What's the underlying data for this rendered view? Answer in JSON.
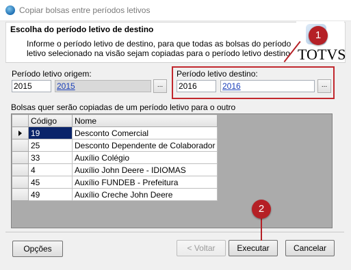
{
  "window": {
    "title": "Copiar bolsas entre períodos letivos"
  },
  "header": {
    "title": "Escolha do período letivo de destino",
    "description": "Informe o período letivo de destino, para que todas as bolsas do período letivo selecionado na visão sejam copiadas para o período letivo destino",
    "logo_text": "TOTVS"
  },
  "origin": {
    "label": "Período letivo origem:",
    "code": "2015",
    "display": "2015",
    "browse_label": "..."
  },
  "destination": {
    "label": "Período letivo destino:",
    "code": "2016",
    "display": "2016",
    "browse_label": "..."
  },
  "grid": {
    "label": "Bolsas quer serão copiadas de um período letivo para o outro",
    "columns": [
      "Código",
      "Nome"
    ],
    "rows": [
      {
        "codigo": "19",
        "nome": "Desconto Comercial"
      },
      {
        "codigo": "25",
        "nome": "Desconto Dependente de Colaborador"
      },
      {
        "codigo": "33",
        "nome": "Auxílio Colégio"
      },
      {
        "codigo": "4",
        "nome": "Auxílio John Deere - IDIOMAS"
      },
      {
        "codigo": "45",
        "nome": "Auxílio FUNDEB - Prefeitura"
      },
      {
        "codigo": "49",
        "nome": "Auxílio Creche John Deere"
      }
    ]
  },
  "buttons": {
    "options": "Opções",
    "back": "< Voltar",
    "execute": "Executar",
    "cancel": "Cancelar"
  },
  "callouts": {
    "one": "1",
    "two": "2"
  },
  "colors": {
    "callout": "#b52026",
    "selection": "#0a246a",
    "link": "#1a3fb8"
  }
}
